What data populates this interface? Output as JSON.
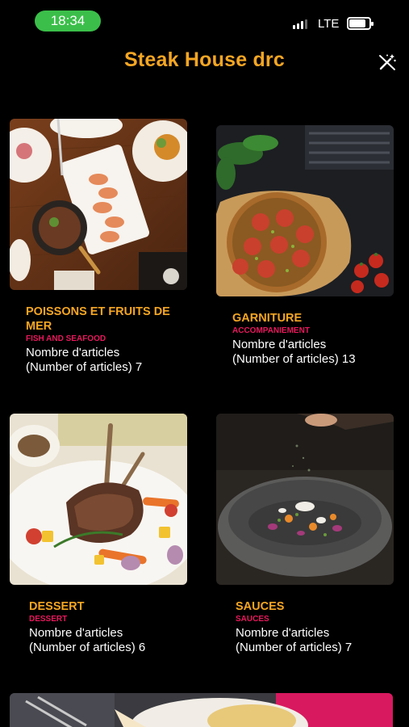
{
  "status_bar": {
    "time": "18:34",
    "network": "LTE",
    "battery_level": 0.85
  },
  "header": {
    "title": "Steak House drc",
    "action_icon": "no-magic-wand-icon"
  },
  "categories": [
    {
      "title": "POISSONS ET FRUITS DE MER",
      "subtitle": "FISH AND SEAFOOD",
      "count_line1": "Nombre d'articles",
      "count_line2": "(Number of articles) 7",
      "image": "seafood-platter-image"
    },
    {
      "title": "GARNITURE",
      "subtitle": "ACCOMPANIEMENT",
      "count_line1": "Nombre d'articles",
      "count_line2": "(Number of articles) 13",
      "image": "tomato-tart-image"
    },
    {
      "title": "DESSERT",
      "subtitle": "DESSERT",
      "count_line1": "Nombre d'articles",
      "count_line2": "(Number of articles) 6",
      "image": "lamb-rack-image"
    },
    {
      "title": "SAUCES",
      "subtitle": "SAUCES",
      "count_line1": "Nombre d'articles",
      "count_line2": "(Number of articles) 7",
      "image": "stone-bowl-image"
    }
  ],
  "colors": {
    "accent": "#f5a623",
    "subtitle": "#e8185d",
    "background": "#000000",
    "status_pill": "#3bbf4a"
  }
}
